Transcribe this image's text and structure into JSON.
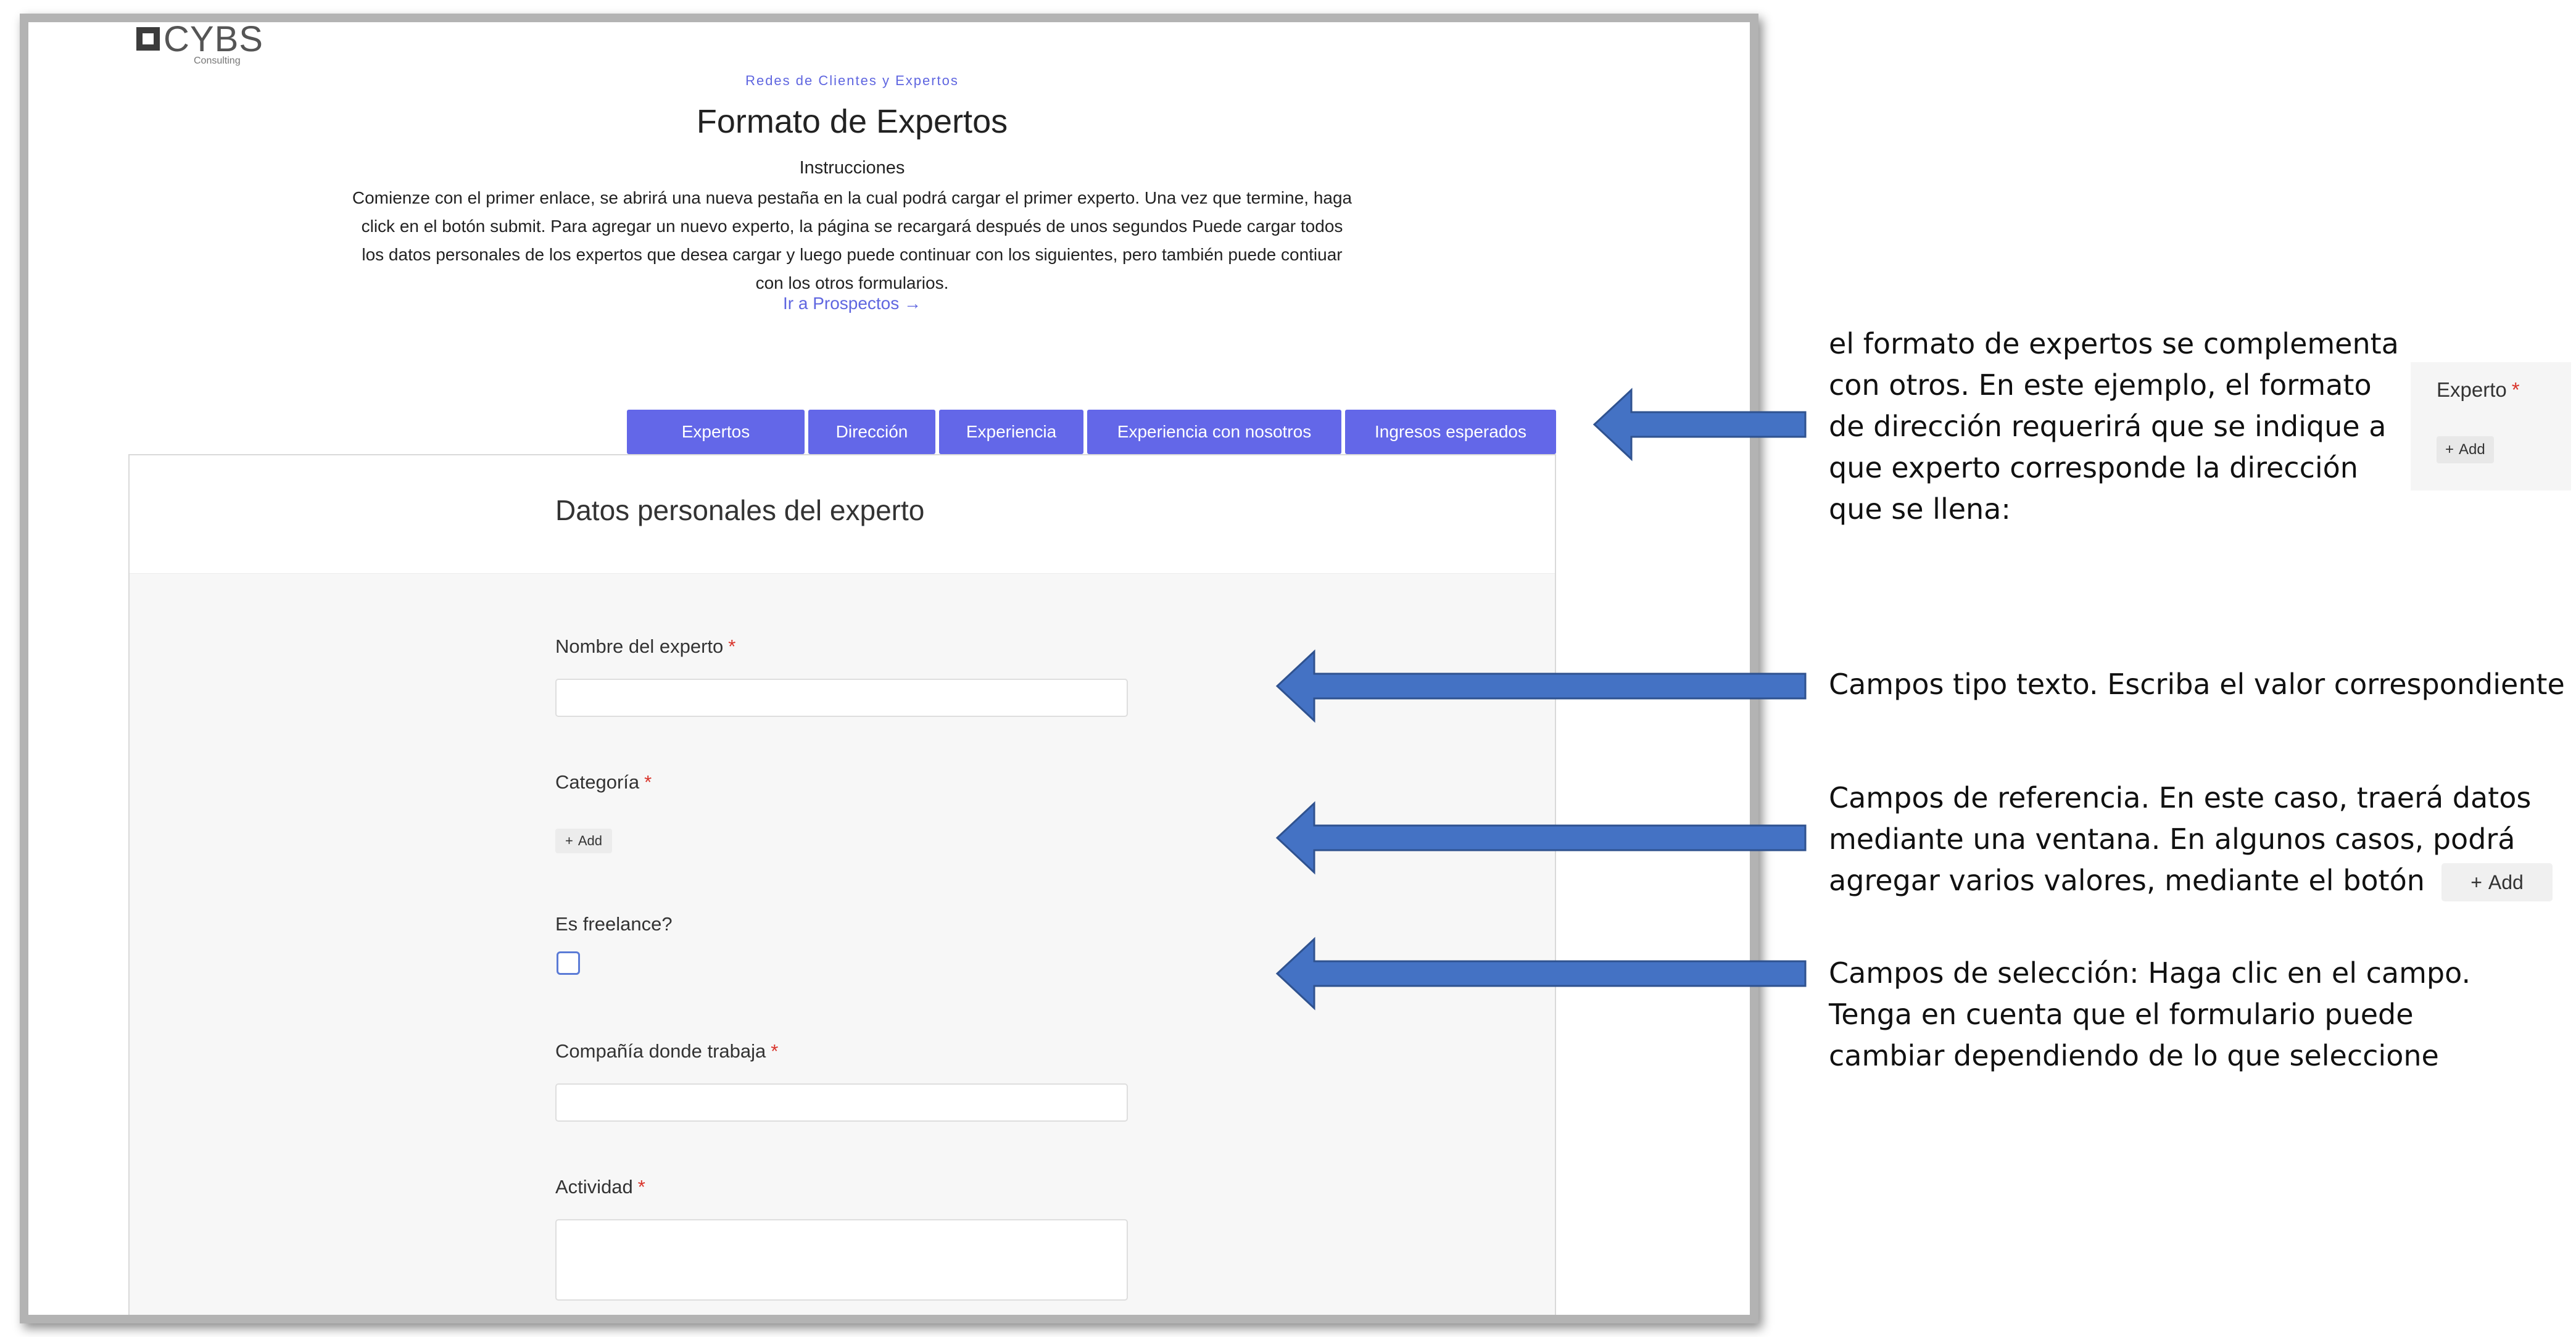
{
  "app": {
    "logo_text": "CYBS",
    "logo_sub": "Consulting",
    "subtitle": "Redes de Clientes y Expertos",
    "title": "Formato de Expertos",
    "instructions_heading": "Instrucciones",
    "instructions_body": "Comienze con el primer enlace, se abrirá una nueva pestaña en la cual podrá cargar el primer experto. Una vez que termine, haga click en el botón submit. Para agregar un nuevo experto, la página se recargará después de unos segundos Puede cargar todos los datos personales de los expertos que desea cargar y luego puede continuar con los siguientes, pero también puede contiuar con los otros formularios.",
    "link_label": "Ir a Prospectos →"
  },
  "tabs": [
    {
      "label": "Expertos"
    },
    {
      "label": "Dirección"
    },
    {
      "label": "Experiencia"
    },
    {
      "label": "Experiencia con nosotros"
    },
    {
      "label": "Ingresos esperados"
    }
  ],
  "form": {
    "title": "Datos personales del experto",
    "fields": {
      "nombre": {
        "label": "Nombre del experto",
        "required": "*",
        "value": ""
      },
      "categoria": {
        "label": "Categoría",
        "required": "*",
        "add_label": "Add"
      },
      "freelance": {
        "label": "Es freelance?",
        "checked": false
      },
      "compania": {
        "label": "Compañía donde trabaja",
        "required": "*",
        "value": ""
      },
      "actividad": {
        "label": "Actividad",
        "required": "*",
        "value": ""
      }
    }
  },
  "annotations": {
    "note1": "el formato de expertos se complementa con otros. En este ejemplo, el formato de dirección requerirá que se indique a que experto corresponde la dirección que se llena:",
    "note2": "Campos tipo texto. Escriba el valor correspondiente",
    "note3": "Campos de referencia. En este caso, traerá datos mediante una ventana. En algunos casos, podrá agregar varios valores, mediante el botón",
    "note4": "Campos de selección: Haga clic en el campo. Tenga en cuenta que el formulario puede cambiar dependiendo de lo que seleccione",
    "inset_label": "Experto",
    "inset_required": "*",
    "inset_add": "Add",
    "inline_add": "Add"
  },
  "colors": {
    "accent": "#6367e8",
    "arrow": "#4472c4",
    "required": "#d9342b"
  }
}
